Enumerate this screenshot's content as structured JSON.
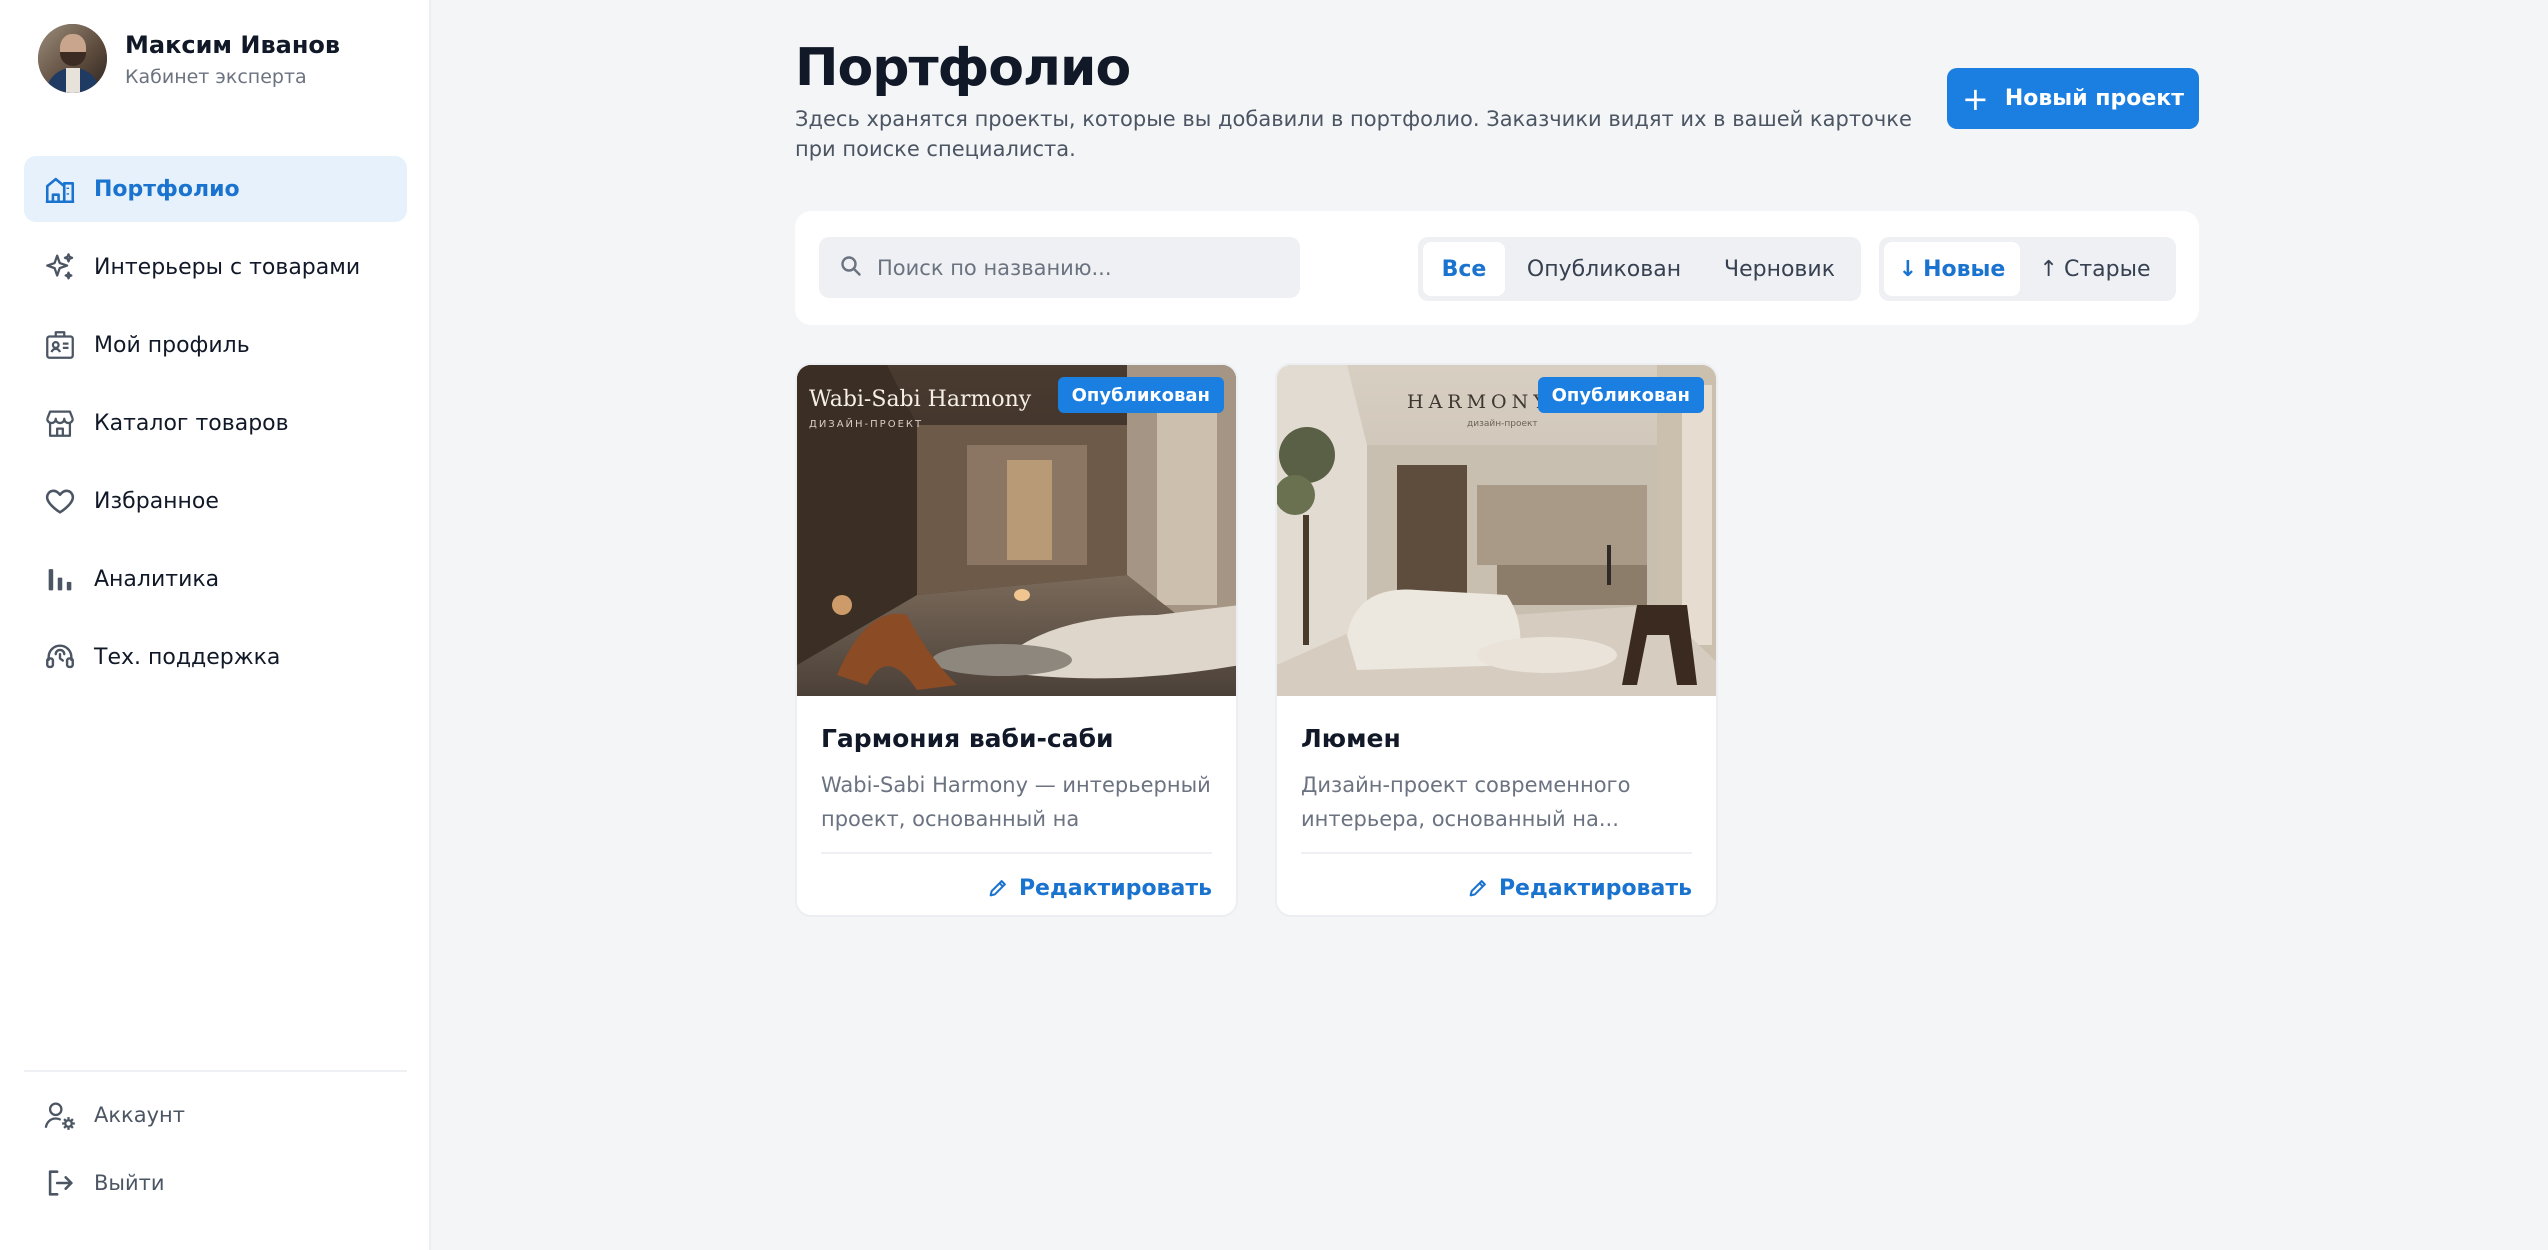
{
  "user": {
    "name": "Максим Иванов",
    "role": "Кабинет эксперта"
  },
  "nav": {
    "items": [
      {
        "label": "Портфолио",
        "icon": "home-building-icon",
        "active": true
      },
      {
        "label": "Интерьеры с товарами",
        "icon": "sparkles-icon"
      },
      {
        "label": "Мой профиль",
        "icon": "id-card-icon"
      },
      {
        "label": "Каталог товаров",
        "icon": "store-icon"
      },
      {
        "label": "Избранное",
        "icon": "heart-icon"
      },
      {
        "label": "Аналитика",
        "icon": "bar-chart-icon"
      },
      {
        "label": "Тех. поддержка",
        "icon": "headset-icon"
      }
    ],
    "bottom": [
      {
        "label": "Аккаунт",
        "icon": "user-settings-icon"
      },
      {
        "label": "Выйти",
        "icon": "logout-icon"
      }
    ]
  },
  "header": {
    "title": "Портфолио",
    "description": "Здесь хранятся проекты, которые вы добавили в портфолио. Заказчики видят их в вашей карточке при поиске специалиста.",
    "new_button": "Новый проект"
  },
  "toolbar": {
    "search_placeholder": "Поиск по названию...",
    "filters": [
      "Все",
      "Опубликован",
      "Черновик"
    ],
    "active_filter": "Все",
    "sort": [
      "Новые",
      "Старые"
    ],
    "active_sort": "Новые"
  },
  "cards": [
    {
      "badge": "Опубликован",
      "image_title": "Wabi-Sabi Harmony",
      "image_subtitle": "ДИЗАЙН-ПРОЕКТ",
      "title": "Гармония ваби-саби",
      "description": "Wabi-Sabi Harmony — интерьерный проект, основанный на гармонии...",
      "edit": "Редактировать"
    },
    {
      "badge": "Опубликован",
      "image_title": "HARMONY HAV",
      "image_subtitle": "дизайн-проект",
      "title": "Люмен",
      "description": "Дизайн-проект современного интерьера, основанный на...",
      "edit": "Редактировать"
    }
  ],
  "colors": {
    "accent": "#1a7fe0",
    "accent_text": "#1a73cf",
    "active_bg": "#e6f1fc",
    "page_bg": "#f4f5f7"
  }
}
